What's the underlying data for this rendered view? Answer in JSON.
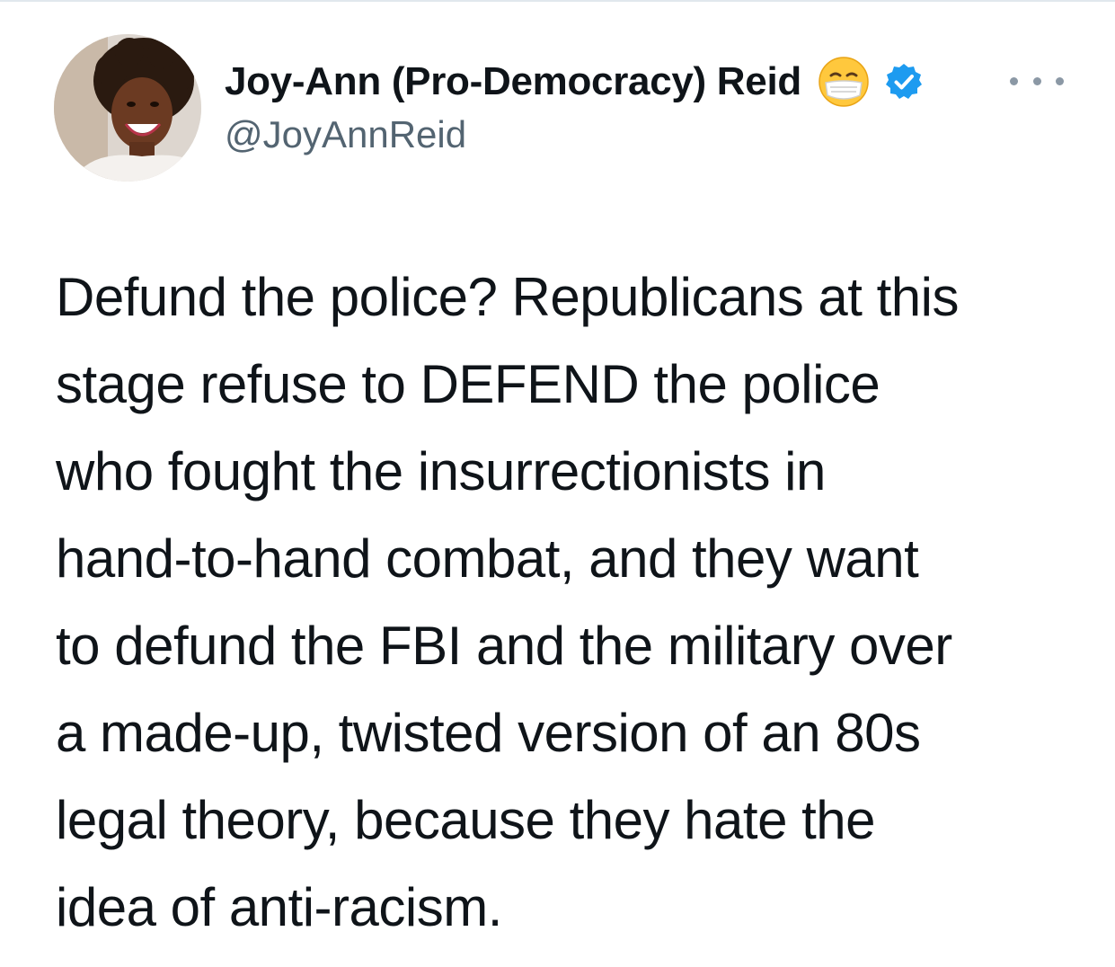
{
  "tweet": {
    "author": {
      "display_name": "Joy-Ann (Pro-Democracy) Reid",
      "handle": "@JoyAnnReid",
      "avatar": "profile-photo",
      "emoji": "face-with-medical-mask",
      "verified": true,
      "verified_color": "#1d9bf0"
    },
    "more_icon": "ellipsis-icon",
    "text_lines": [
      "Defund the police? Republicans at this",
      "stage refuse to DEFEND the police",
      "who fought the insurrectionists in",
      "hand-to-hand combat, and they want",
      "to defund the FBI and the military over",
      "a made-up, twisted version of an 80s",
      "legal theory, because they hate the",
      "idea of anti-racism."
    ]
  }
}
